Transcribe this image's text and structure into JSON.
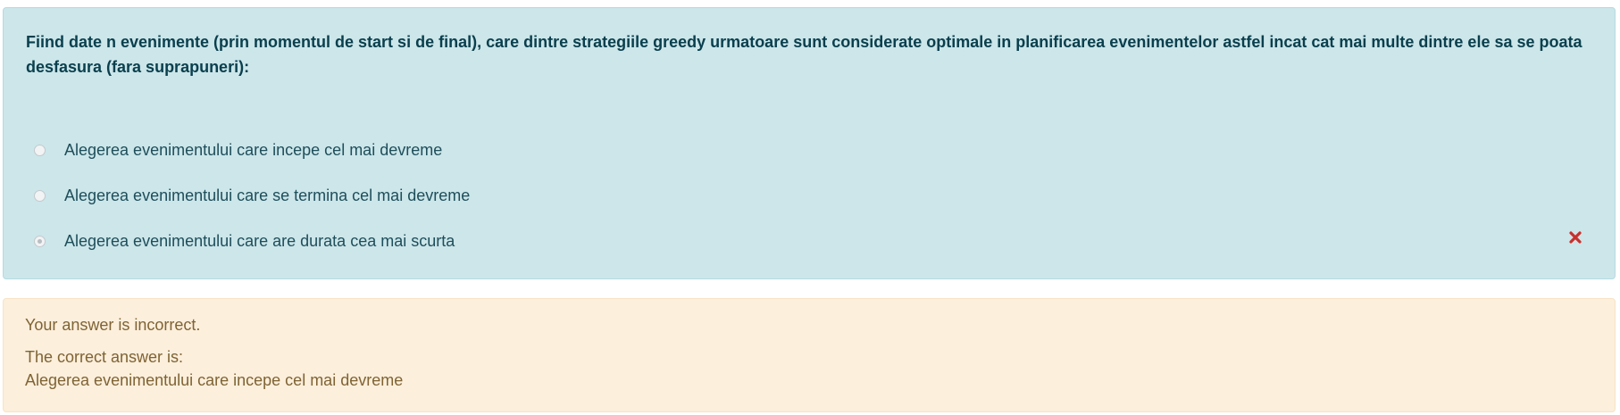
{
  "question": {
    "text": "Fiind date n evenimente (prin momentul de start si de final), care dintre strategiile greedy urmatoare sunt considerate optimale in planificarea evenimentelor astfel incat cat mai multe dintre ele sa se poata desfasura (fara suprapuneri):",
    "options": [
      {
        "label": "Alegerea evenimentului care incepe cel mai devreme",
        "selected": false
      },
      {
        "label": "Alegerea evenimentului care se termina cel mai devreme",
        "selected": false
      },
      {
        "label": "Alegerea evenimentului care are durata cea mai scurta",
        "selected": true,
        "status_icon": "incorrect-cross-icon"
      }
    ]
  },
  "feedback": {
    "result": "Your answer is incorrect.",
    "correct_title": "The correct answer is:",
    "correct_answer": "Alegerea evenimentului care incepe cel mai devreme"
  },
  "colors": {
    "question_background": "#cce6ea",
    "feedback_background": "#fcefdc",
    "incorrect_icon": "#c9302c"
  }
}
